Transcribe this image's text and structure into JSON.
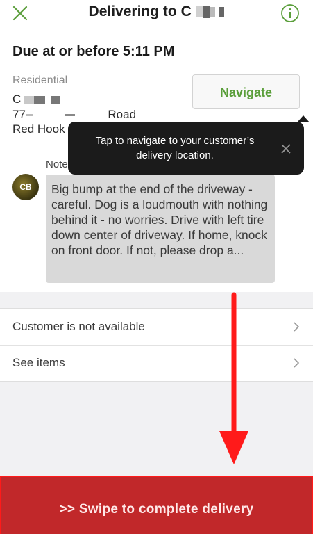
{
  "header": {
    "title": "Delivering to C"
  },
  "order": {
    "due": "Due at or before 5:11 PM",
    "address_type": "Residential",
    "address_line1": "C",
    "address_line2_prefix": "77",
    "address_line2_suffix": "Road",
    "address_line3": "Red Hook",
    "navigate_label": "Navigate"
  },
  "tooltip": {
    "text": "Tap to navigate to your customer’s delivery location."
  },
  "notes": {
    "label": "Note",
    "avatar_initials": "CB",
    "text": "Big bump at the end of the driveway - careful. Dog is a loudmouth with nothing behind it - no worries. Drive with left tire down center of driveway. If home, knock on front door. If not, please drop a..."
  },
  "actions": {
    "items": [
      {
        "label": "Customer is not available"
      },
      {
        "label": "See items"
      }
    ]
  },
  "swipe": {
    "label": ">> Swipe to complete delivery"
  },
  "colors": {
    "accent_green": "#5a9e3a",
    "swipe_red": "#c1282a",
    "annotation_red": "#ff1a1a"
  }
}
